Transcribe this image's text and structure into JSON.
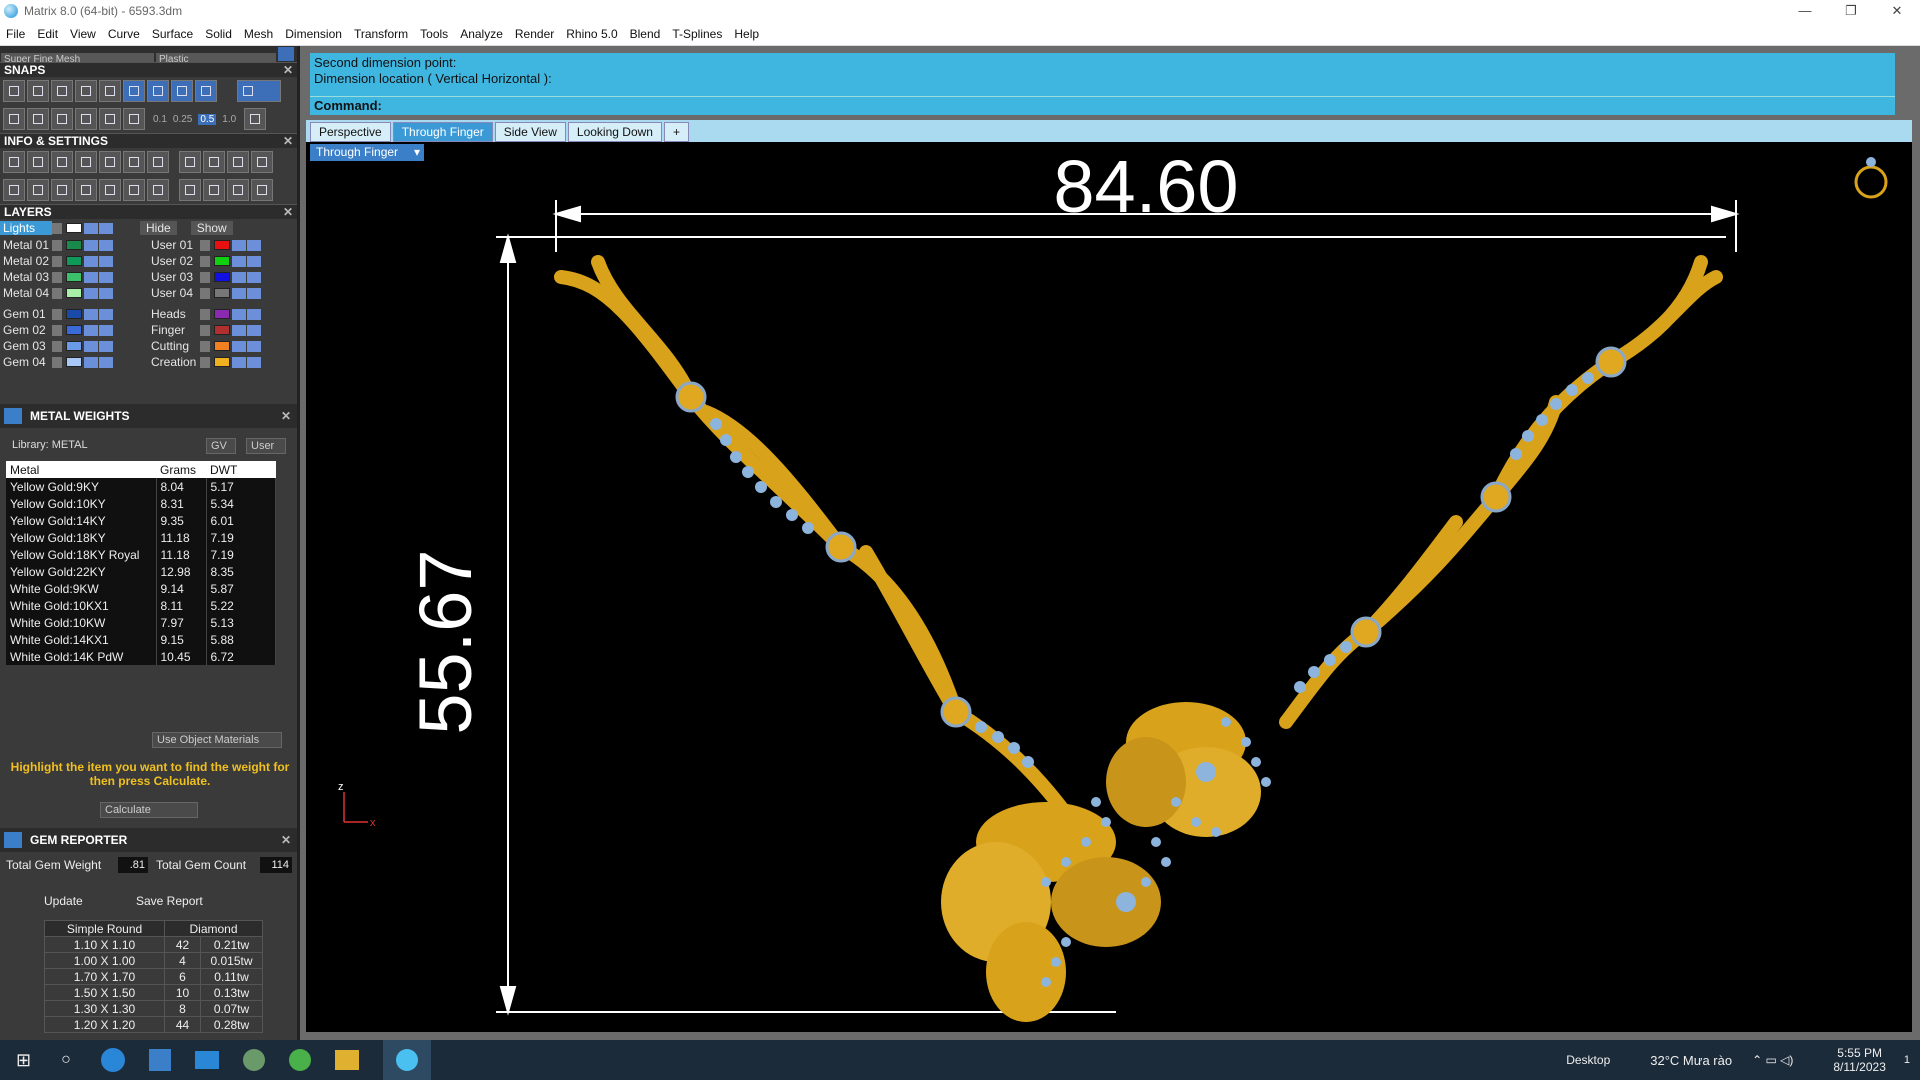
{
  "window": {
    "title": "Matrix 8.0 (64-bit) - 6593.3dm",
    "min": "—",
    "max": "❐",
    "close": "✕"
  },
  "menu": [
    "File",
    "Edit",
    "View",
    "Curve",
    "Surface",
    "Solid",
    "Mesh",
    "Dimension",
    "Transform",
    "Tools",
    "Analyze",
    "Render",
    "Rhino 5.0",
    "Blend",
    "T-Splines",
    "Help"
  ],
  "left": {
    "mesh_select": "Super Fine Mesh",
    "material_select": "Plastic",
    "snaps_title": "SNAPS",
    "snap_values": [
      "0.1",
      "0.25",
      "0.5",
      "1.0"
    ],
    "info_title": "INFO & SETTINGS",
    "layers_title": "LAYERS",
    "lights_label": "Lights",
    "hide_label": "Hide",
    "show_label": "Show",
    "layers_left": [
      {
        "name": "Metal 01",
        "color": "#1a8a4a"
      },
      {
        "name": "Metal 02",
        "color": "#0f9a5a"
      },
      {
        "name": "Metal 03",
        "color": "#3cc06a"
      },
      {
        "name": "Metal 04",
        "color": "#a8f0a8"
      },
      {
        "name": "Gem 01",
        "color": "#1a4aa8"
      },
      {
        "name": "Gem 02",
        "color": "#3a6ad8"
      },
      {
        "name": "Gem 03",
        "color": "#6a9ae8"
      },
      {
        "name": "Gem 04",
        "color": "#a8c8f8"
      }
    ],
    "layers_right": [
      {
        "name": "User 01",
        "color": "#e81010"
      },
      {
        "name": "User 02",
        "color": "#10d010"
      },
      {
        "name": "User 03",
        "color": "#1010e0"
      },
      {
        "name": "User 04",
        "color": "#777777"
      },
      {
        "name": "Heads",
        "color": "#8a2ab0"
      },
      {
        "name": "Finger",
        "color": "#b03030"
      },
      {
        "name": "Cutting",
        "color": "#f08020"
      },
      {
        "name": "Creation",
        "color": "#f0b020"
      }
    ],
    "metal_weights": {
      "title": "METAL WEIGHTS",
      "library": "Library: METAL",
      "gv_label": "GV",
      "user_label": "User",
      "columns": [
        "Metal",
        "Grams",
        "DWT"
      ],
      "rows": [
        [
          "Yellow Gold:9KY",
          "8.04",
          "5.17"
        ],
        [
          "Yellow Gold:10KY",
          "8.31",
          "5.34"
        ],
        [
          "Yellow Gold:14KY",
          "9.35",
          "6.01"
        ],
        [
          "Yellow Gold:18KY",
          "11.18",
          "7.19"
        ],
        [
          "Yellow Gold:18KY Royal",
          "11.18",
          "7.19"
        ],
        [
          "Yellow Gold:22KY",
          "12.98",
          "8.35"
        ],
        [
          "White Gold:9KW",
          "9.14",
          "5.87"
        ],
        [
          "White Gold:10KX1",
          "8.11",
          "5.22"
        ],
        [
          "White Gold:10KW",
          "7.97",
          "5.13"
        ],
        [
          "White Gold:14KX1",
          "9.15",
          "5.88"
        ],
        [
          "White Gold:14K PdW",
          "10.45",
          "6.72"
        ]
      ],
      "use_object_materials": "Use Object Materials",
      "hint": "Highlight the item you want to find the weight for then press Calculate.",
      "calculate": "Calculate"
    },
    "gem_reporter": {
      "title": "GEM REPORTER",
      "total_weight_label": "Total Gem Weight",
      "total_weight": ".81",
      "total_count_label": "Total Gem Count",
      "total_count": "114",
      "update": "Update",
      "save_report": "Save Report",
      "col_shape": "Simple Round",
      "col_type": "Diamond",
      "rows": [
        [
          "1.10 X 1.10",
          "42",
          "0.21tw"
        ],
        [
          "1.00 X 1.00",
          "4",
          "0.015tw"
        ],
        [
          "1.70 X 1.70",
          "6",
          "0.11tw"
        ],
        [
          "1.50 X 1.50",
          "10",
          "0.13tw"
        ],
        [
          "1.30 X 1.30",
          "8",
          "0.07tw"
        ],
        [
          "1.20 X 1.20",
          "44",
          "0.28tw"
        ]
      ]
    }
  },
  "command": {
    "line1": "Second dimension point:",
    "line2": "Dimension location ( Vertical  Horizontal ):",
    "label": "Command:"
  },
  "tabs": [
    "Perspective",
    "Through Finger",
    "Side View",
    "Looking Down",
    "+"
  ],
  "viewport": {
    "label": "Through Finger",
    "dim_width": "84.60",
    "dim_height": "55.67",
    "axis_z": "z",
    "axis_x": "x"
  },
  "taskbar": {
    "desktop": "Desktop",
    "weather": "32°C  Mưa rào",
    "time": "5:55 PM",
    "date": "8/11/2023",
    "notif": "1"
  }
}
